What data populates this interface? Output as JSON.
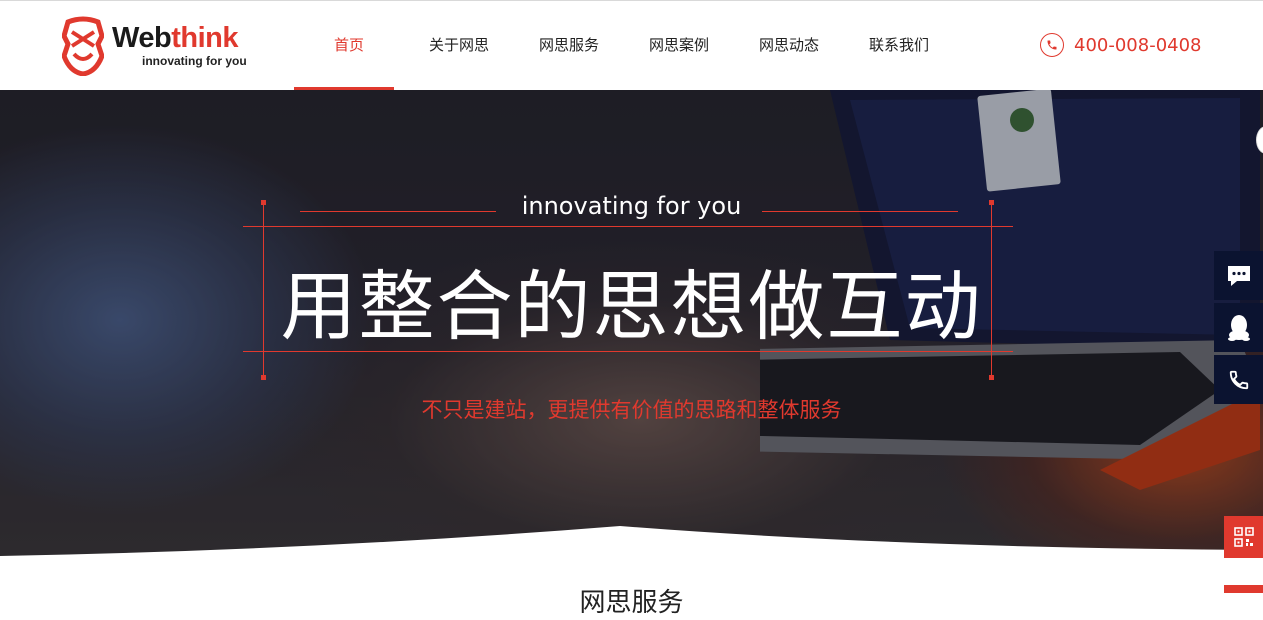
{
  "header": {
    "logo_web": "Web",
    "logo_think": "think",
    "logo_slogan": "innovating for you",
    "nav": [
      {
        "label": "首页",
        "active": true
      },
      {
        "label": "关于网思",
        "active": false
      },
      {
        "label": "网思服务",
        "active": false
      },
      {
        "label": "网思案例",
        "active": false
      },
      {
        "label": "网思动态",
        "active": false
      },
      {
        "label": "联系我们",
        "active": false
      }
    ],
    "phone": "400-008-0408"
  },
  "banner": {
    "tagline": "innovating for you",
    "headline": "用整合的思想做互动",
    "subline": "不只是建站，更提供有价值的思路和整体服务"
  },
  "sidebar": {
    "items": [
      "message-icon",
      "qq-icon",
      "phone-icon",
      "qrcode-icon"
    ]
  },
  "section": {
    "title": "网思服务"
  },
  "colors": {
    "accent": "#e0392e",
    "sidebar": "#0b1330"
  }
}
